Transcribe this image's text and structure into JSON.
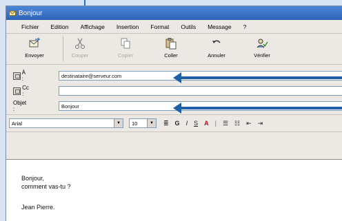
{
  "window": {
    "title": "Bonjour"
  },
  "menu": [
    "Fichier",
    "Edition",
    "Affichage",
    "Insertion",
    "Format",
    "Outils",
    "Message",
    "?"
  ],
  "toolbar": [
    {
      "label": "Envoyer",
      "icon": "send-icon",
      "enabled": true
    },
    {
      "label": "Couper",
      "icon": "cut-icon",
      "enabled": false
    },
    {
      "label": "Copier",
      "icon": "copy-icon",
      "enabled": false
    },
    {
      "label": "Coller",
      "icon": "paste-icon",
      "enabled": true
    },
    {
      "label": "Annuler",
      "icon": "undo-icon",
      "enabled": true
    },
    {
      "label": "Vérifier",
      "icon": "check-names-icon",
      "enabled": true
    }
  ],
  "fields": {
    "to_label": "À :",
    "to_value": "destinataire@serveur.com",
    "cc_label": "Cc :",
    "cc_value": "",
    "subject_label": "Objet :",
    "subject_value": "Bonjour"
  },
  "format": {
    "font": "Arial",
    "size": "10"
  },
  "message_lines": [
    "Bonjour,",
    "comment vas-tu ?",
    "",
    "Jean Pierre."
  ],
  "colors": {
    "title_bar": "#2c63b8",
    "arrow": "#1f5fa8"
  }
}
